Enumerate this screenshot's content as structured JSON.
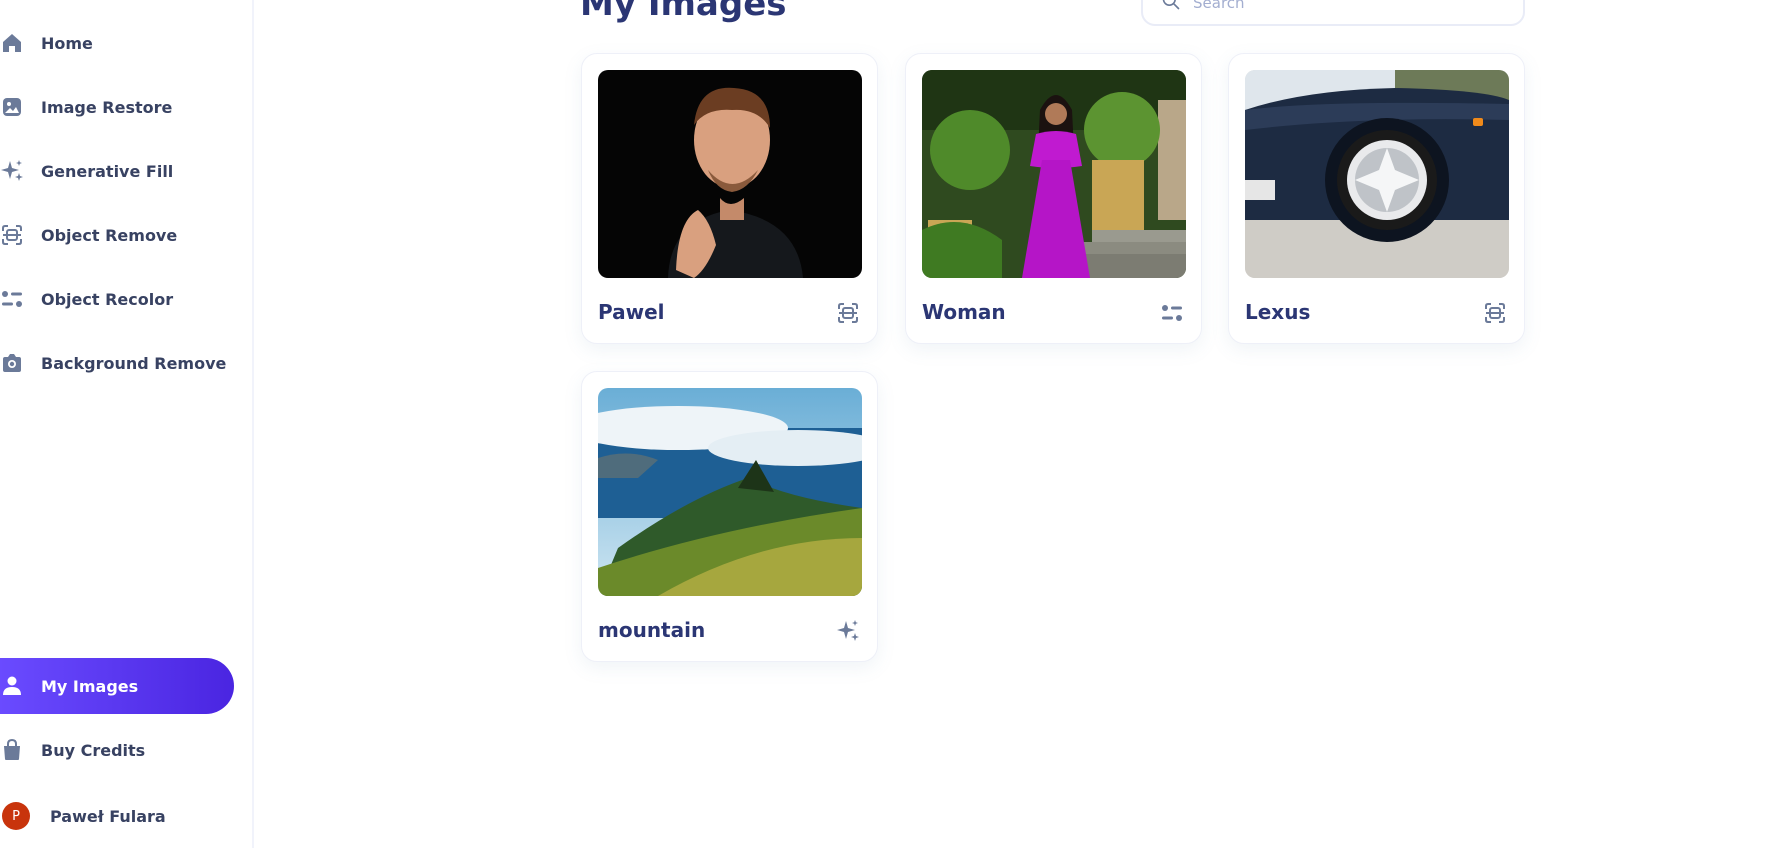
{
  "sidebar": {
    "items": [
      {
        "label": "Home",
        "icon": "home-icon"
      },
      {
        "label": "Image Restore",
        "icon": "image-icon"
      },
      {
        "label": "Generative Fill",
        "icon": "sparkles-icon"
      },
      {
        "label": "Object Remove",
        "icon": "scan-object-icon"
      },
      {
        "label": "Object Recolor",
        "icon": "sliders-icon"
      },
      {
        "label": "Background Remove",
        "icon": "camera-icon"
      }
    ],
    "bottom_items": [
      {
        "label": "My Images",
        "icon": "user-icon",
        "active": true
      },
      {
        "label": "Buy Credits",
        "icon": "bag-icon"
      }
    ],
    "user": {
      "initial": "P",
      "name": "Paweł Fulara"
    }
  },
  "main": {
    "title": "My Images",
    "search": {
      "placeholder": "Search"
    },
    "cards": [
      {
        "name": "Pawel",
        "tool_icon": "scan-object-icon",
        "image": "portrait of man in black shirt"
      },
      {
        "name": "Woman",
        "tool_icon": "sliders-icon",
        "image": "woman in magenta dress in garden"
      },
      {
        "name": "Lexus",
        "tool_icon": "scan-object-icon",
        "image": "dark blue car wheel"
      },
      {
        "name": "mountain",
        "tool_icon": "sparkles-icon",
        "image": "green mountain ridge above sea"
      }
    ]
  },
  "colors": {
    "accent": "#5a36f0",
    "text_dark": "#2b3674",
    "nav_text": "#384262",
    "icon": "#6b7a99",
    "avatar": "#c8340c"
  }
}
